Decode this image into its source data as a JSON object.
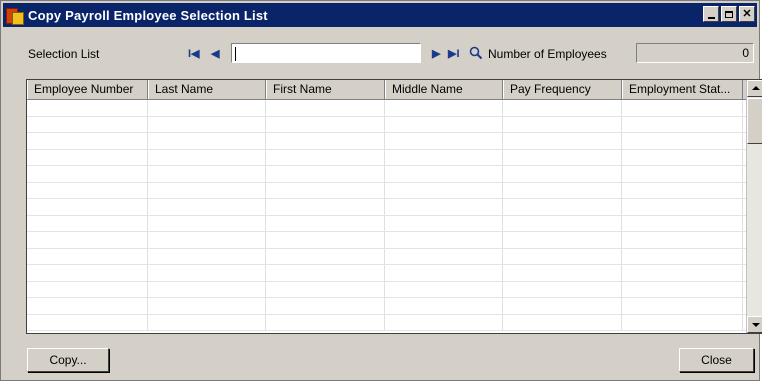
{
  "window": {
    "title": "Copy Payroll Employee Selection List"
  },
  "toolbar": {
    "selection_label": "Selection List",
    "selection_value": "",
    "first_glyph": "I◀",
    "prev_glyph": "◀",
    "next_glyph": "▶",
    "last_glyph": "▶I",
    "count_label": "Number of Employees",
    "count_value": "0"
  },
  "grid": {
    "columns": [
      "Employee Number",
      "Last Name",
      "First Name",
      "Middle Name",
      "Pay Frequency",
      "Employment Stat..."
    ],
    "rows": []
  },
  "buttons": {
    "copy": "Copy...",
    "close": "Close"
  },
  "colors": {
    "titlebar": "#0a246a",
    "face": "#d4d0c8"
  },
  "icons": [
    "app-icon",
    "first-record-icon",
    "previous-record-icon",
    "next-record-icon",
    "last-record-icon",
    "search-icon",
    "minimize-icon",
    "maximize-icon",
    "close-icon"
  ]
}
